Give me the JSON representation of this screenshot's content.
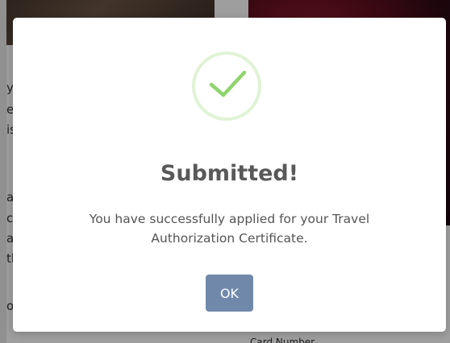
{
  "modal": {
    "title": "Submitted!",
    "message": "You have successfully applied for your Travel Authorization Certificate.",
    "ok_label": "OK",
    "icon": "success-check-icon",
    "accent_color": "#a5dc86",
    "button_color": "#7089ab"
  },
  "background": {
    "fragments": [
      "y",
      "e",
      "is",
      "a",
      "c",
      "ai",
      "th",
      "or"
    ],
    "bottom_right_text": "Card Number"
  }
}
